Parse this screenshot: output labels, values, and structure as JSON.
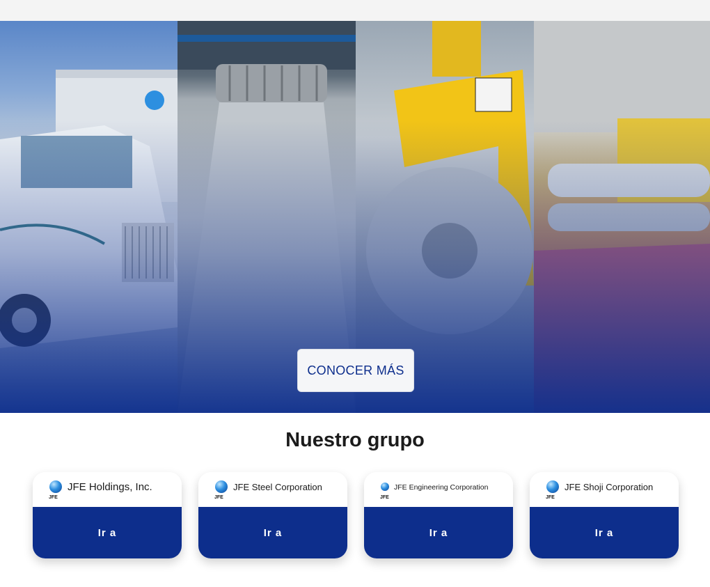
{
  "hero": {
    "cta_label": "CONOCER MÁS"
  },
  "group": {
    "title": "Nuestro grupo",
    "cards": [
      {
        "company": "JFE Holdings, Inc.",
        "logo_mark": "JFE",
        "button": "Ir a"
      },
      {
        "company": "JFE Steel Corporation",
        "logo_mark": "JFE",
        "button": "Ir a"
      },
      {
        "company": "JFE Engineering Corporation",
        "logo_mark": "JFE",
        "button": "Ir a"
      },
      {
        "company": "JFE Shoji Corporation",
        "logo_mark": "JFE",
        "button": "Ir a"
      }
    ]
  },
  "colors": {
    "brand_blue": "#0d2e8c",
    "cta_background": "#f5f6f8"
  }
}
